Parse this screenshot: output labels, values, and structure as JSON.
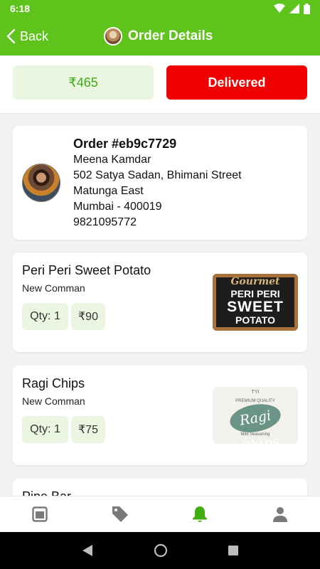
{
  "status_bar": {
    "time": "6:18"
  },
  "header": {
    "back_label": "Back",
    "title": "Order Details"
  },
  "summary": {
    "amount": "₹465",
    "status": "Delivered"
  },
  "order": {
    "number": "Order #eb9c7729",
    "customer_name": "Meena Kamdar",
    "address_line1": "502 Satya Sadan, Bhimani Street",
    "address_line2": "Matunga East",
    "city": "Mumbai - 400019",
    "phone": "9821095772"
  },
  "items": [
    {
      "name": "Peri Peri Sweet Potato",
      "brand": "New Comman",
      "qty": "Qty: 1",
      "price": "₹90",
      "image_text": {
        "brand": "Gourmet",
        "line1": "PERI PERI",
        "line2": "SWEET",
        "line3": "POTATO"
      }
    },
    {
      "name": "Ragi Chips",
      "brand": "New Comman",
      "qty": "Qty: 1",
      "price": "₹75",
      "image_text": {
        "brand": "TYI",
        "tag": "PREMIUM QUALITY",
        "name": "Ragi Chips",
        "note": "Mild Seasoning"
      }
    },
    {
      "name": "Pipe Bar"
    }
  ],
  "bottom_nav": {
    "items": [
      {
        "icon": "orders-icon",
        "active": false
      },
      {
        "icon": "tag-icon",
        "active": false
      },
      {
        "icon": "bell-icon",
        "active": true
      },
      {
        "icon": "profile-icon",
        "active": false
      }
    ]
  },
  "colors": {
    "brand_green": "#5ec41c",
    "accent_green": "#3fae0e",
    "light_green": "#eaf6e2",
    "status_red": "#f00000",
    "inactive_icon": "#7a7a7a"
  }
}
